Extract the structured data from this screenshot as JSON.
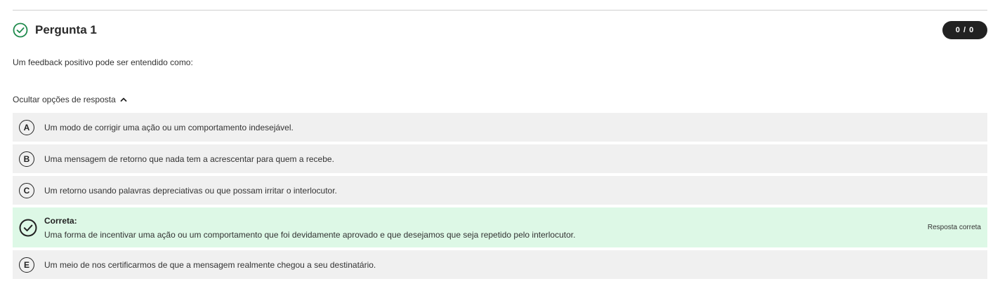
{
  "question": {
    "title": "Pergunta 1",
    "score": "0 / 0",
    "text": "Um feedback positivo pode ser entendido como:",
    "status_icon": "check-circle-icon",
    "status_color": "#1e8a4c"
  },
  "options_toggle": {
    "label": "Ocultar opções de resposta",
    "icon": "chevron-up-icon"
  },
  "options": [
    {
      "letter": "A",
      "text": "Um modo de corrigir uma ação ou um comportamento indesejável."
    },
    {
      "letter": "B",
      "text": "Uma mensagem de retorno que nada tem a acrescentar para quem a recebe."
    },
    {
      "letter": "C",
      "text": "Um retorno usando palavras depreciativas ou que possam irritar o interlocutor."
    },
    {
      "label": "Correta:",
      "text": "Uma forma de incentivar uma ação ou um comportamento que foi devidamente aprovado e que desejamos que seja repetido pelo interlocutor.",
      "tag": "Resposta correta",
      "icon": "check-circle-icon",
      "background": "#ddf8e6"
    },
    {
      "letter": "E",
      "text": "Um meio de nos certificarmos de que a mensagem realmente chegou a seu destinatário."
    }
  ]
}
